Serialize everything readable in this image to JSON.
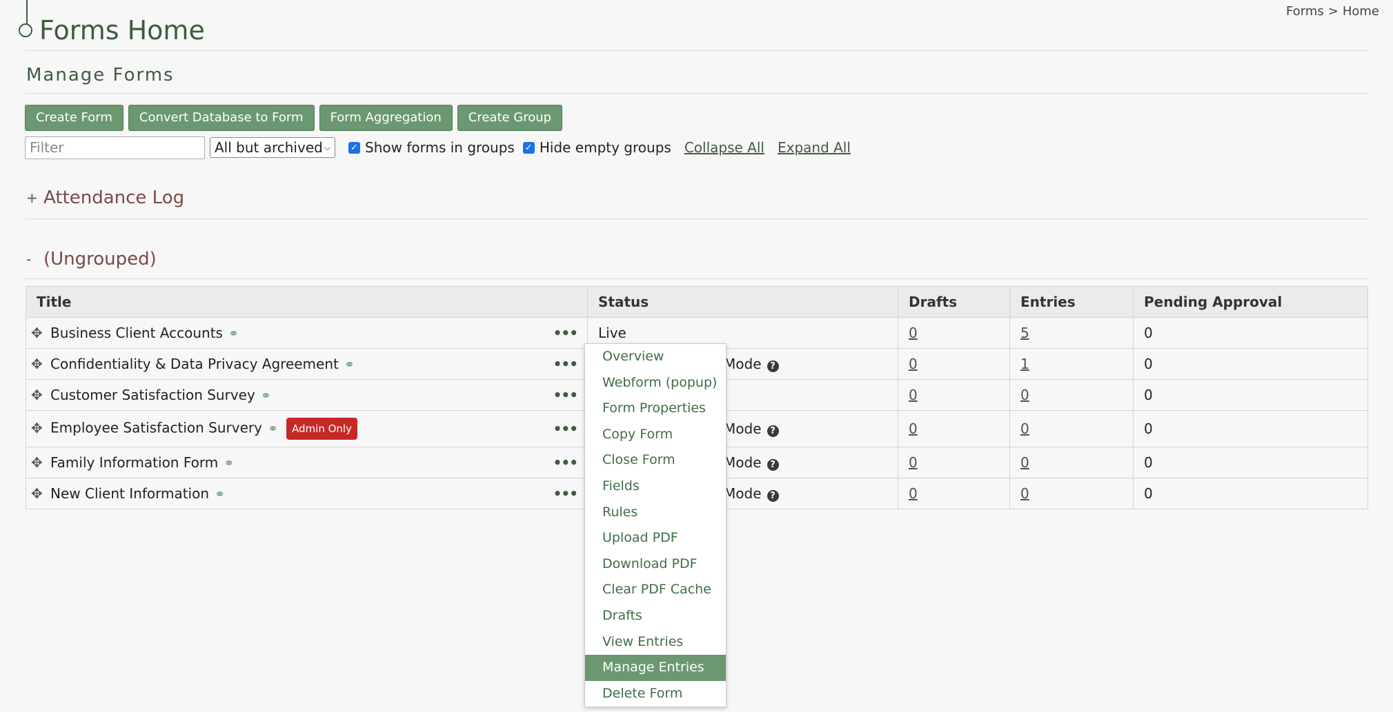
{
  "page": {
    "title": "Forms Home"
  },
  "breadcrumb": {
    "items": [
      "Forms",
      ">",
      "Home"
    ]
  },
  "section": {
    "title": "Manage Forms"
  },
  "toolbar": {
    "create_form": "Create Form",
    "convert_db": "Convert Database to Form",
    "aggregation": "Form Aggregation",
    "create_group": "Create Group"
  },
  "filters": {
    "filter_placeholder": "Filter",
    "archive_select": "All but archived",
    "show_in_groups": "Show forms in groups",
    "hide_empty": "Hide empty groups",
    "collapse_all": "Collapse All",
    "expand_all": "Expand All"
  },
  "groups": [
    {
      "toggle": "+",
      "name": "Attendance Log"
    },
    {
      "toggle": "-",
      "name": "(Ungrouped)"
    }
  ],
  "table": {
    "headers": [
      "Title",
      "Status",
      "Drafts",
      "Entries",
      "Pending Approval"
    ],
    "rows": [
      {
        "title": "Business Client Accounts",
        "status": "Live",
        "drafts": "0",
        "entries": "5",
        "pending": "0"
      },
      {
        "title": "Confidentiality & Data Privacy Agreement",
        "status": "Mode",
        "drafts": "0",
        "entries": "1",
        "pending": "0"
      },
      {
        "title": "Customer Satisfaction Survey",
        "status": "",
        "drafts": "0",
        "entries": "0",
        "pending": "0"
      },
      {
        "title": "Employee Satisfaction Survery",
        "badge": "Admin Only",
        "status": "Mode",
        "drafts": "0",
        "entries": "0",
        "pending": "0"
      },
      {
        "title": "Family Information Form",
        "status": "Mode",
        "drafts": "0",
        "entries": "0",
        "pending": "0"
      },
      {
        "title": "New Client Information",
        "status": "Mode",
        "drafts": "0",
        "entries": "0",
        "pending": "0"
      }
    ]
  },
  "context_menu": {
    "items": [
      "Overview",
      "Webform (popup)",
      "Form Properties",
      "Copy Form",
      "Close Form",
      "Fields",
      "Rules",
      "Upload PDF",
      "Download PDF",
      "Clear PDF Cache",
      "Drafts",
      "View Entries",
      "Manage Entries",
      "Delete Form"
    ],
    "active": "Manage Entries"
  },
  "icons": {
    "drag": "move-arrows-icon",
    "chain": "link-chain-icon",
    "dots": "more-options-icon",
    "help": "help-circle-icon"
  },
  "colors": {
    "accent": "#6b9870",
    "title": "#405a40",
    "group": "#7a4a4a",
    "badge": "#c62828"
  }
}
